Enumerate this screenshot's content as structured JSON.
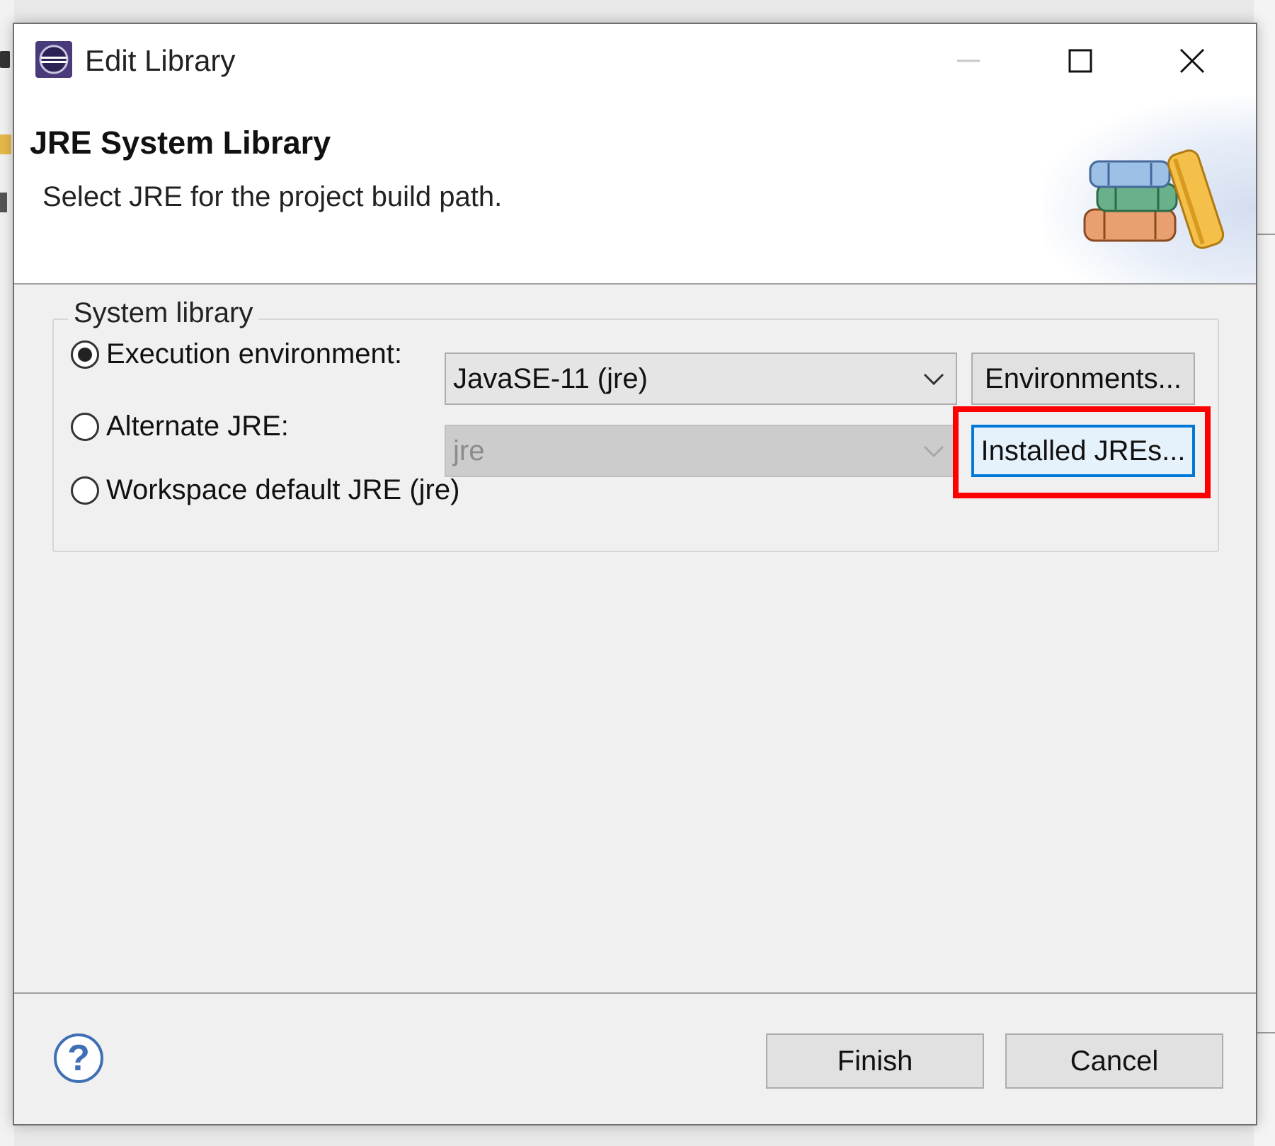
{
  "window": {
    "title": "Edit Library",
    "icons": {
      "app": "eclipse-icon",
      "minimize": "minimize-icon",
      "maximize": "maximize-icon",
      "close": "close-icon"
    }
  },
  "header": {
    "title": "JRE System Library",
    "description": "Select JRE for the project build path.",
    "image": "library-books-icon"
  },
  "system_library": {
    "legend": "System library",
    "execution_environment": {
      "label": "Execution environment:",
      "selected": true,
      "value": "JavaSE-11 (jre)",
      "button": "Environments..."
    },
    "alternate_jre": {
      "label": "Alternate JRE:",
      "selected": false,
      "value": "jre",
      "enabled": false,
      "button": "Installed JREs..."
    },
    "workspace_default": {
      "label": "Workspace default JRE (jre)",
      "selected": false
    }
  },
  "footer": {
    "help_icon": "help-icon",
    "finish": "Finish",
    "cancel": "Cancel"
  },
  "colors": {
    "highlight": "#ff0000",
    "focus_border": "#0078d7",
    "dialog_bg": "#f0f0f0"
  }
}
